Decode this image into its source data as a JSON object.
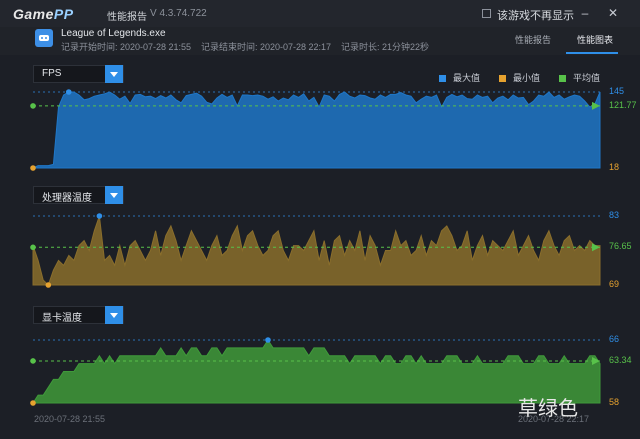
{
  "app": {
    "logo_left": "Game",
    "logo_right": "PP",
    "window_title": "性能报告",
    "version": "V 4.3.74.722",
    "hide_checkbox_label": "该游戏不再显示"
  },
  "session": {
    "app_name": "League of Legends.exe",
    "start_time": "记录开始时间: 2020-07-28 21:55",
    "end_time": "记录结束时间: 2020-07-28 22:17",
    "duration": "记录时长: 21分钟22秒"
  },
  "tabs": [
    {
      "label": "性能报告",
      "active": false
    },
    {
      "label": "性能图表",
      "active": true
    }
  ],
  "legend": [
    {
      "label": "最大值",
      "color": "#2f8fe8"
    },
    {
      "label": "最小值",
      "color": "#e6a22f"
    },
    {
      "label": "平均值",
      "color": "#58c24a"
    }
  ],
  "chart_data": [
    {
      "type": "area",
      "title": "FPS",
      "color": "#1f77c8",
      "max": 145,
      "min": 18,
      "avg": 121.77,
      "labels": {
        "max": "145",
        "min": "18",
        "avg": "121.77"
      },
      "ylim": [
        18,
        145
      ],
      "values": [
        18,
        22,
        22,
        22,
        24,
        120,
        140,
        145,
        145,
        140,
        132,
        134,
        138,
        140,
        142,
        145,
        140,
        133,
        138,
        126,
        140,
        141,
        137,
        138,
        134,
        139,
        135,
        140,
        132,
        127,
        139,
        141,
        143,
        138,
        128,
        125,
        135,
        141,
        136,
        140,
        122,
        140,
        140,
        139,
        140,
        138,
        133,
        137,
        130,
        135,
        132,
        140,
        136,
        142,
        130,
        136,
        120,
        140,
        138,
        130,
        141,
        145,
        138,
        135,
        140,
        139,
        135,
        133,
        140,
        136,
        141,
        141,
        144,
        140,
        138,
        127,
        133,
        138,
        136,
        140,
        120,
        136,
        141,
        137,
        140,
        134,
        133,
        140,
        136,
        138,
        127,
        135,
        138,
        132,
        140,
        135,
        136,
        124,
        130,
        140,
        138,
        145,
        136,
        140,
        133,
        137,
        140,
        138,
        130,
        120,
        125,
        145
      ]
    },
    {
      "type": "area",
      "title": "处理器温度",
      "color": "#8a6e2c",
      "max": 83,
      "min": 69,
      "avg": 76.65,
      "labels": {
        "max": "83",
        "min": "69",
        "avg": "76.65"
      },
      "ylim": [
        69,
        83
      ],
      "values": [
        77,
        74,
        70,
        69,
        72,
        74,
        73,
        75,
        74,
        77,
        78,
        76,
        80,
        83,
        74,
        75,
        73,
        77,
        73,
        77,
        78,
        76,
        74,
        76,
        80,
        75,
        79,
        81,
        78,
        74,
        77,
        80,
        78,
        76,
        74,
        77,
        79,
        75,
        76,
        79,
        81,
        76,
        79,
        80,
        77,
        75,
        76,
        79,
        80,
        76,
        74,
        77,
        77,
        76,
        78,
        80,
        74,
        78,
        73,
        78,
        79,
        75,
        78,
        76,
        80,
        74,
        79,
        77,
        73,
        76,
        76,
        80,
        77,
        78,
        75,
        76,
        79,
        75,
        78,
        77,
        80,
        81,
        79,
        76,
        77,
        80,
        74,
        77,
        79,
        75,
        78,
        77,
        76,
        78,
        80,
        75,
        77,
        79,
        76,
        74,
        78,
        80,
        77,
        75,
        78,
        79,
        76,
        77,
        76,
        78,
        77,
        77
      ]
    },
    {
      "type": "area",
      "title": "显卡温度",
      "color": "#3f9a3a",
      "max": 66,
      "min": 58,
      "avg": 63.34,
      "labels": {
        "max": "66",
        "min": "58",
        "avg": "63.34"
      },
      "ylim": [
        58,
        66
      ],
      "values": [
        58,
        59,
        59,
        60,
        61,
        61,
        62,
        62,
        62,
        63,
        63,
        63,
        63,
        64,
        63,
        64,
        63,
        64,
        64,
        64,
        64,
        64,
        64,
        64,
        64,
        65,
        64,
        64,
        64,
        65,
        64,
        65,
        65,
        64,
        64,
        65,
        65,
        64,
        65,
        65,
        65,
        65,
        65,
        65,
        65,
        65,
        66,
        65,
        65,
        65,
        65,
        65,
        65,
        65,
        64,
        65,
        65,
        65,
        64,
        64,
        64,
        64,
        63,
        64,
        64,
        64,
        64,
        64,
        63,
        64,
        64,
        63,
        63,
        64,
        64,
        63,
        64,
        63,
        63,
        63,
        63,
        64,
        64,
        64,
        63,
        63,
        63,
        64,
        63,
        63,
        63,
        63,
        63,
        64,
        64,
        64,
        63,
        63,
        63,
        64,
        64,
        63,
        63,
        63,
        64,
        63,
        63,
        63,
        63,
        64,
        64,
        63
      ]
    }
  ],
  "x_axis": {
    "start": "2020-07-28 21:55",
    "end": "2020-07-28 22:17"
  },
  "watermark": "草绿色"
}
